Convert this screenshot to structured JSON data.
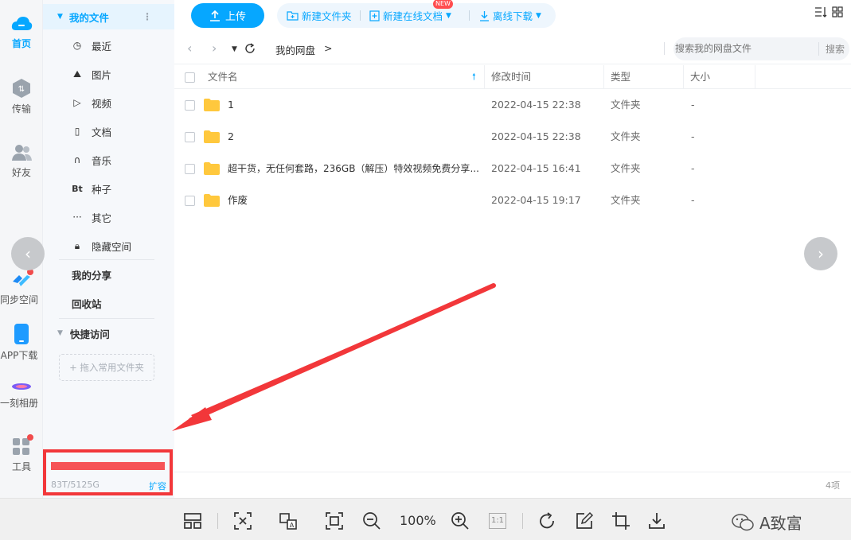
{
  "rail": {
    "home": "首页",
    "transfer": "传输",
    "friends": "好友",
    "sync": "同步空间",
    "app": "APP下载",
    "album": "一刻相册",
    "tools": "工具"
  },
  "sidebar": {
    "my_files": "我的文件",
    "items": [
      {
        "label": "最近",
        "icon": "clock-icon"
      },
      {
        "label": "图片",
        "icon": "image-icon"
      },
      {
        "label": "视频",
        "icon": "play-icon"
      },
      {
        "label": "文档",
        "icon": "document-icon"
      },
      {
        "label": "音乐",
        "icon": "headphones-icon"
      },
      {
        "label": "种子",
        "icon": "bt-icon"
      },
      {
        "label": "其它",
        "icon": "more-icon"
      },
      {
        "label": "隐藏空间",
        "icon": "lock-icon"
      }
    ],
    "my_share": "我的分享",
    "recycle": "回收站",
    "quick_access": "快捷访问",
    "drop_hint": "+ 拖入常用文件夹",
    "quota": "83T/5125G",
    "expand": "扩容"
  },
  "toolbar": {
    "upload": "上传",
    "new_folder": "新建文件夹",
    "new_online_doc": "新建在线文档",
    "new_badge": "NEW",
    "offline_download": "离线下载"
  },
  "nav": {
    "breadcrumb": "我的网盘",
    "crumb_sep": ">",
    "search_placeholder": "搜索我的网盘文件",
    "search_button": "搜索"
  },
  "table": {
    "headers": {
      "name": "文件名",
      "modified": "修改时间",
      "type": "类型",
      "size": "大小"
    },
    "rows": [
      {
        "name": "1",
        "modified": "2022-04-15 22:38",
        "type": "文件夹",
        "size": "-"
      },
      {
        "name": "2",
        "modified": "2022-04-15 22:38",
        "type": "文件夹",
        "size": "-"
      },
      {
        "name": "超干货，无任何套路，236GB（解压）特效视频免费分享...",
        "modified": "2022-04-15 16:41",
        "type": "文件夹",
        "size": "-"
      },
      {
        "name": "作废",
        "modified": "2022-04-15 19:17",
        "type": "文件夹",
        "size": "-"
      }
    ],
    "count": "4项"
  },
  "viewer": {
    "zoom": "100%",
    "ratio": "1:1",
    "watermark": "A致富"
  },
  "colors": {
    "accent": "#06a7ff",
    "annotation_red": "#f2373a",
    "folder": "#ffc83d"
  }
}
